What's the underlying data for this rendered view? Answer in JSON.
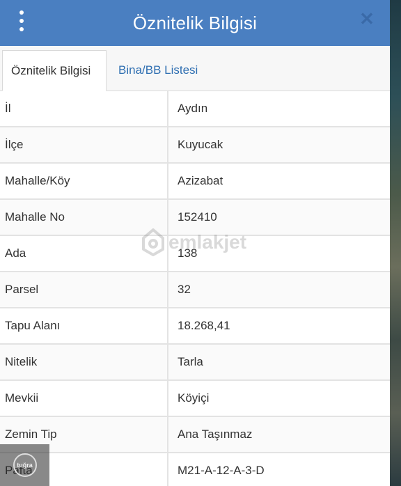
{
  "header": {
    "title": "Öznitelik Bilgisi"
  },
  "tabs": [
    {
      "label": "Öznitelik Bilgisi",
      "active": true
    },
    {
      "label": "Bina/BB Listesi",
      "active": false
    }
  ],
  "rows": [
    {
      "label": "İl",
      "value": "Aydın"
    },
    {
      "label": "İlçe",
      "value": "Kuyucak"
    },
    {
      "label": "Mahalle/Köy",
      "value": "Azizabat"
    },
    {
      "label": "Mahalle No",
      "value": "152410"
    },
    {
      "label": "Ada",
      "value": "138"
    },
    {
      "label": "Parsel",
      "value": "32"
    },
    {
      "label": "Tapu Alanı",
      "value": "18.268,41"
    },
    {
      "label": "Nitelik",
      "value": "Tarla"
    },
    {
      "label": "Mevkii",
      "value": "Köyiçi"
    },
    {
      "label": "Zemin Tip",
      "value": "Ana Taşınmaz"
    },
    {
      "label": "Pafta",
      "value": "M21-A-12-A-3-D"
    }
  ],
  "watermark": {
    "text": "emlakjet",
    "icon": "house-pin-icon"
  },
  "badge": {
    "text": "tuğra",
    "icon": "circle-logo-icon"
  },
  "colors": {
    "header_bg": "#4a7fc1",
    "tab_link": "#2e6eb1"
  },
  "icons": {
    "menu": "vertical-dots-icon",
    "close": "close-icon"
  }
}
